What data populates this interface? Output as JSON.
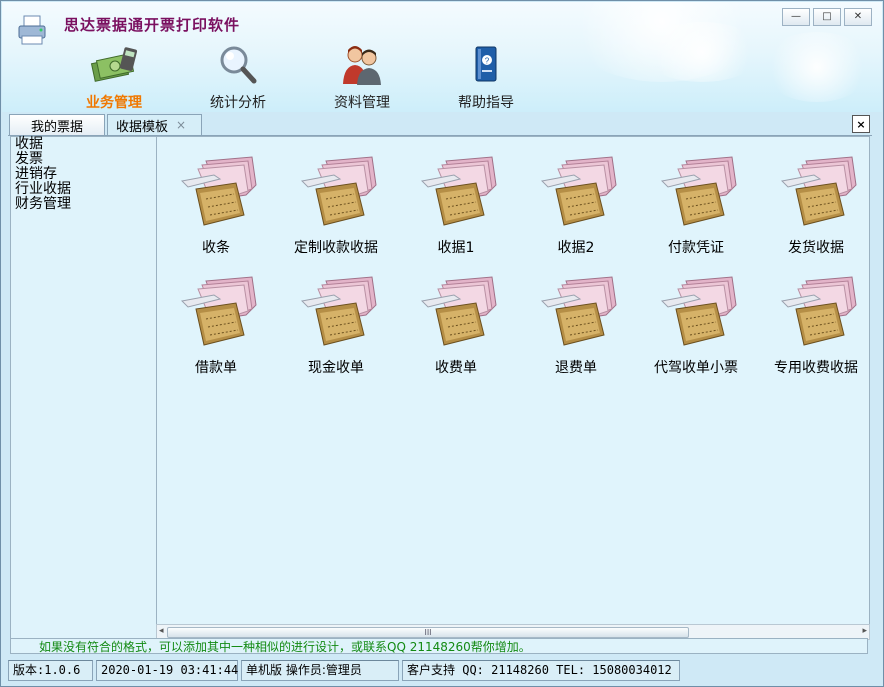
{
  "app": {
    "title": "思达票据通开票打印软件"
  },
  "window_controls": {
    "minimize": "—",
    "restore": "□",
    "close": "✕"
  },
  "nav": {
    "items": [
      {
        "label": "业务管理",
        "icon": "money-calculator-icon",
        "active": true
      },
      {
        "label": "统计分析",
        "icon": "magnifier-icon",
        "active": false
      },
      {
        "label": "资料管理",
        "icon": "people-icon",
        "active": false
      },
      {
        "label": "帮助指导",
        "icon": "help-book-icon",
        "active": false
      }
    ]
  },
  "tabs": [
    {
      "label": "我的票据",
      "active": false
    },
    {
      "label": "收据模板",
      "active": true,
      "close": "×"
    }
  ],
  "panel_close": "×",
  "sidebar": {
    "items": [
      "收据",
      "发票",
      "进销存",
      "行业收据",
      "财务管理"
    ]
  },
  "templates": [
    "收条",
    "定制收款收据",
    "收据1",
    "收据2",
    "付款凭证",
    "发货收据",
    "借款单",
    "现金收单",
    "收费单",
    "退费单",
    "代驾收单小票",
    "专用收费收据"
  ],
  "scrollbar": {
    "grip": "III",
    "left": "◂",
    "right": "▸"
  },
  "tip": "如果没有符合的格式，可以添加其中一种相似的进行设计，或联系QQ 21148260帮你增加。",
  "status": {
    "version": "版本:1.0.6",
    "datetime": "2020-01-19 03:41:44",
    "mode": "单机版 操作员:管理员",
    "support": "客户支持 QQ: 21148260 TEL: 15080034012"
  },
  "colors": {
    "title": "#7a1060",
    "active_nav": "#f07800",
    "tip": "#138a13",
    "background": "#cfe9f6"
  }
}
